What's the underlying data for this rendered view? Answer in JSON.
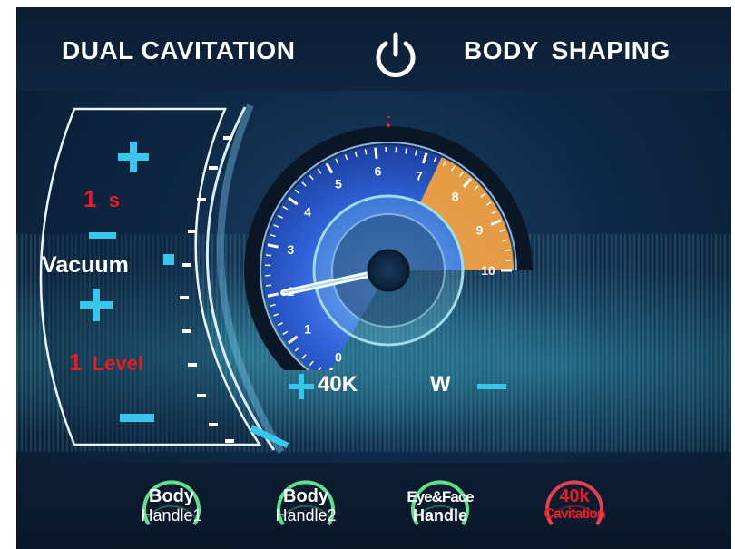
{
  "header": {
    "left_title": "DUAL CAVITATION",
    "right_title": "BODY  SHAPING",
    "power_icon": "power-icon"
  },
  "vacuum": {
    "label": "Vacuum",
    "time_value": "1",
    "time_unit": "s",
    "level_value": "1",
    "level_unit": "Level"
  },
  "gauge": {
    "tick_labels": [
      "0",
      "1",
      "2",
      "3",
      "4",
      "5",
      "6",
      "7",
      "8",
      "9",
      "10"
    ],
    "needle_value": 2,
    "max_value": 10,
    "warning_zone": [
      7.3,
      10
    ]
  },
  "power": {
    "frequency": "40K",
    "unit": "W"
  },
  "handles": [
    {
      "line1": "Body",
      "line2": "Handle1"
    },
    {
      "line1": "Body",
      "line2": "Handle2"
    },
    {
      "line1": "Eye&Face",
      "line2": "Handle"
    },
    {
      "line1": "40k",
      "line2": "Cavitation"
    }
  ],
  "colors": {
    "accent": "#38c6ec",
    "value_red": "#e21f26",
    "warning_orange": "#f0a040",
    "dial_blue": "#2a5bd0"
  }
}
